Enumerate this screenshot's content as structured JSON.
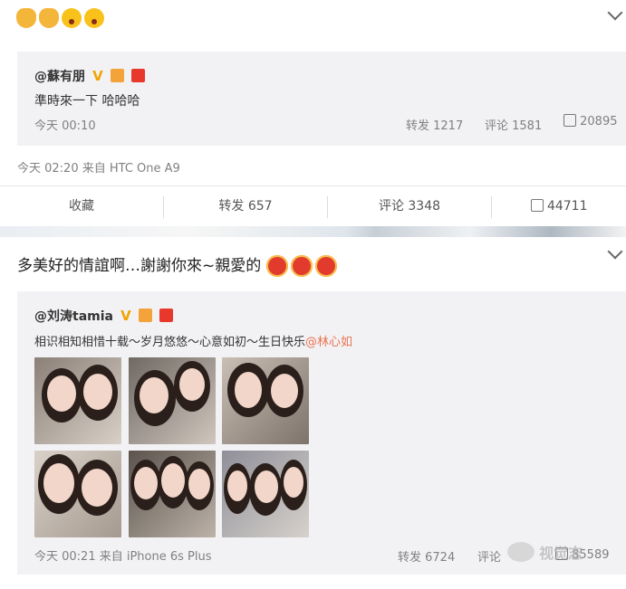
{
  "post1": {
    "emojis": [
      "rock-hand-icon",
      "rock-hand-icon",
      "surprised-face-icon",
      "surprised-face-icon"
    ],
    "repost": {
      "user": "@蘇有朋",
      "badge": "V",
      "text": "準時來一下 哈哈哈",
      "time": "今天 00:10",
      "repost_label": "转发 1217",
      "comment_label": "评论 1581",
      "like_count": "20895"
    },
    "meta": "今天 02:20 来自 HTC One A9",
    "actions": {
      "favorite": "收藏",
      "repost": "转发 657",
      "comment": "评论 3348",
      "like": "44711"
    }
  },
  "post2": {
    "text": "多美好的情誼啊…謝謝你來~親愛的",
    "repost": {
      "user": "@刘涛tamia",
      "badge": "V",
      "text": "相识相知相惜十载～岁月悠悠～心意如初～生日快乐",
      "mention": "@林心如",
      "time_source": "今天 00:21 来自 iPhone 6s Plus",
      "repost_label": "转发 6724",
      "comment_label": "评论",
      "like_count": "85589"
    }
  },
  "watermark": "视觉志",
  "colors": {
    "card_bg": "#f2f2f5",
    "mention": "#eb7350",
    "badge": "#f0a500",
    "red_packet": "#e8372b"
  }
}
